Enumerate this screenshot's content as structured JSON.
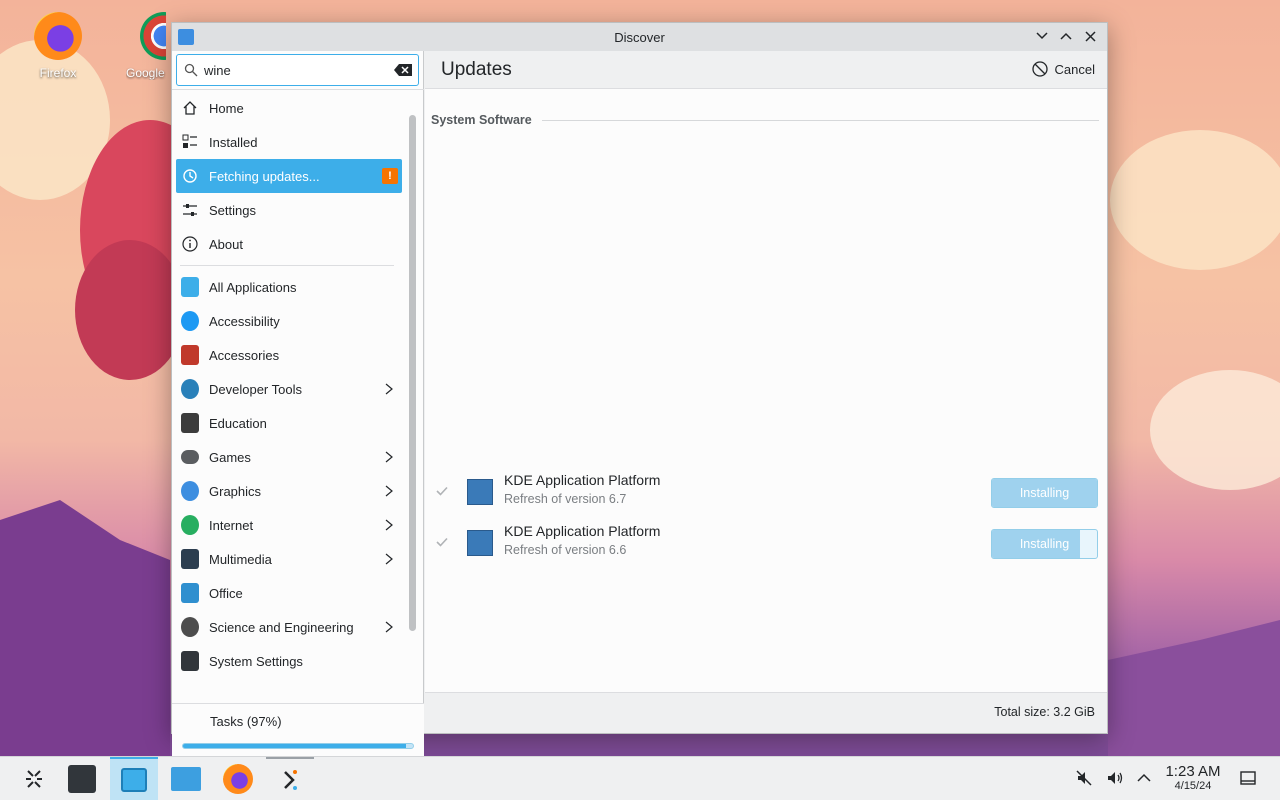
{
  "desktop": {
    "icons": [
      {
        "label": "Firefox",
        "icon": "firefox-icon"
      },
      {
        "label": "Google",
        "icon": "chrome-icon"
      }
    ]
  },
  "window": {
    "title": "Discover",
    "controls": {
      "minimize": "⌄",
      "maximize": "⌃",
      "close": "✕"
    }
  },
  "search": {
    "value": "wine",
    "icon": "search-icon"
  },
  "sidebar": {
    "nav": [
      {
        "label": "Home",
        "icon": "home-icon"
      },
      {
        "label": "Installed",
        "icon": "installed-icon"
      },
      {
        "label": "Fetching updates...",
        "icon": "updates-icon",
        "active": true,
        "badge": "!"
      },
      {
        "label": "Settings",
        "icon": "settings-icon"
      },
      {
        "label": "About",
        "icon": "info-icon"
      }
    ],
    "categories": [
      {
        "label": "All Applications",
        "color": "#3daee9",
        "has_sub": false
      },
      {
        "label": "Accessibility",
        "color": "#1d99f3",
        "has_sub": false
      },
      {
        "label": "Accessories",
        "color": "#c0392b",
        "has_sub": false
      },
      {
        "label": "Developer Tools",
        "color": "#2980b9",
        "has_sub": true
      },
      {
        "label": "Education",
        "color": "#3c3c3c",
        "has_sub": false
      },
      {
        "label": "Games",
        "color": "#5a5d60",
        "has_sub": true
      },
      {
        "label": "Graphics",
        "color": "#3d8ee0",
        "has_sub": true
      },
      {
        "label": "Internet",
        "color": "#27ae60",
        "has_sub": true
      },
      {
        "label": "Multimedia",
        "color": "#2c3e50",
        "has_sub": true
      },
      {
        "label": "Office",
        "color": "#2f8fcf",
        "has_sub": false
      },
      {
        "label": "Science and Engineering",
        "color": "#4d4d4d",
        "has_sub": true
      },
      {
        "label": "System Settings",
        "color": "#31363b",
        "has_sub": false
      }
    ],
    "tasks": {
      "label": "Tasks (97%)",
      "progress": 0.97
    }
  },
  "main": {
    "title": "Updates",
    "cancel_label": "Cancel",
    "section": "System Software",
    "updates": [
      {
        "name": "KDE Application Platform",
        "subtitle": "Refresh of version 6.7",
        "status": "Installing",
        "progress": 1.0
      },
      {
        "name": "KDE Application Platform",
        "subtitle": "Refresh of version 6.6",
        "status": "Installing",
        "progress": 0.84
      }
    ],
    "total_size": "Total size: 3.2 GiB"
  },
  "taskbar": {
    "clock_time": "1:23 AM",
    "clock_date": "4/15/24"
  },
  "colors": {
    "accent": "#3daee9",
    "warning": "#f67400"
  }
}
